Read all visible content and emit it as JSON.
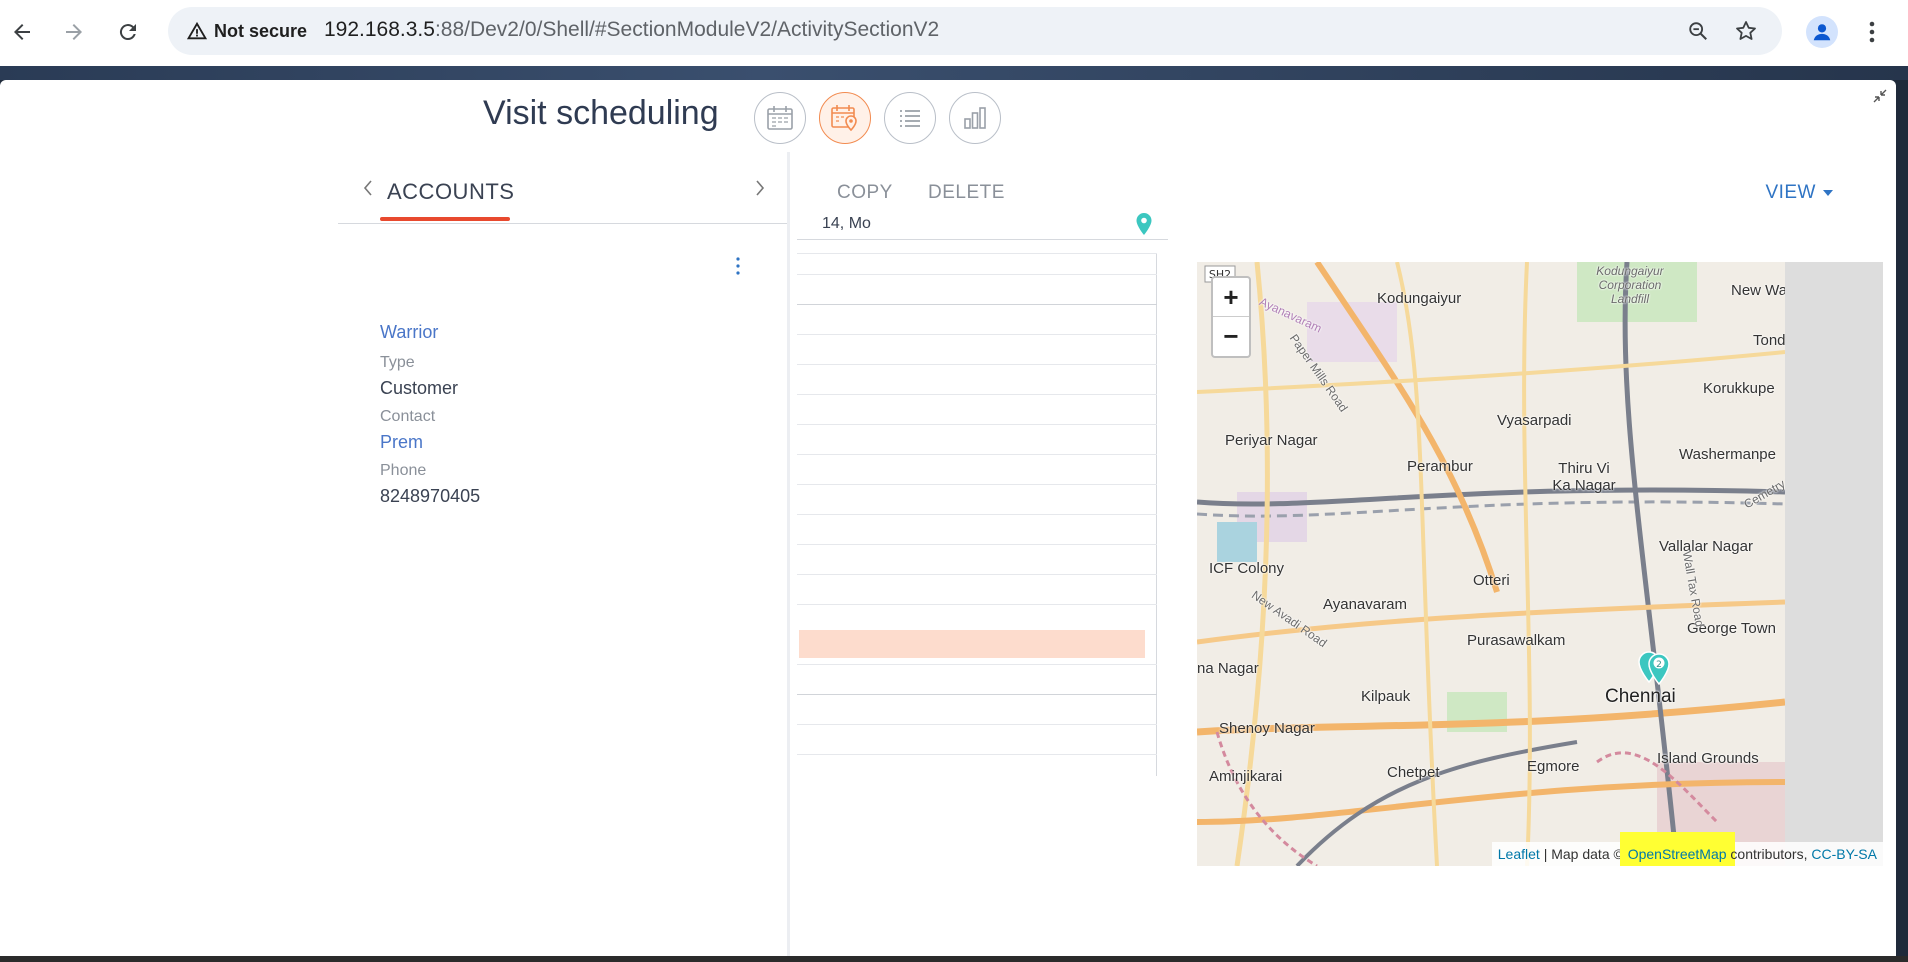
{
  "browser": {
    "security_label": "Not secure",
    "url_host": "192.168.3.5",
    "url_rest": ":88/Dev2/0/Shell/#SectionModuleV2/ActivitySectionV2",
    "icons": [
      "back-arrow-icon",
      "forward-arrow-icon",
      "reload-icon",
      "warning-icon",
      "zoom-icon",
      "star-icon",
      "profile-icon",
      "kebab-menu-icon"
    ]
  },
  "page": {
    "title": "Visit scheduling",
    "view_buttons": [
      {
        "name": "calendar-view",
        "icon": "calendar-icon",
        "active": false
      },
      {
        "name": "calendar-map-view",
        "icon": "calendar-pin-icon",
        "active": true
      },
      {
        "name": "list-view",
        "icon": "list-icon",
        "active": false
      },
      {
        "name": "analytics-view",
        "icon": "bar-chart-icon",
        "active": false
      }
    ]
  },
  "left_panel": {
    "tab_label": "ACCOUNTS",
    "account": {
      "name": "Warrior",
      "type_label": "Type",
      "type_value": "Customer",
      "contact_label": "Contact",
      "contact_value": "Prem",
      "phone_label": "Phone",
      "phone_value": "8248970405"
    }
  },
  "toolbar": {
    "copy_label": "COPY",
    "delete_label": "DELETE",
    "view_label": "VIEW"
  },
  "schedule": {
    "day_label": "14, Mo"
  },
  "map": {
    "zoom_in": "+",
    "zoom_out": "−",
    "attribution_leaflet": "Leaflet",
    "attribution_mid": " | Map data © ",
    "attribution_osm": "OpenStreetMap",
    "attribution_contrib": " contributors, ",
    "attribution_license": "CC-BY-SA",
    "cluster_count": "2",
    "highway_label": "SH2",
    "labels": {
      "kodungaiyur": "Kodungaiyur",
      "landfill": "Kodungaiyur Corporation Landfill",
      "new_wa": "New Wa",
      "tond": "Tond",
      "korukkupet": "Korukkupe",
      "periyar": "Periyar Nagar",
      "vyasarpadi": "Vyasarpadi",
      "perambur": "Perambur",
      "thiru": "Thiru Vi Ka Nagar",
      "washermanpet": "Washermanpe",
      "vallalar": "Vallalar Nagar",
      "icf": "ICF Colony",
      "otteri": "Otteri",
      "ayanavaram": "Ayanavaram",
      "george": "George Town",
      "purasawalkam": "Purasawalkam",
      "chennai": "Chennai",
      "anna": "na Nagar",
      "kilpauk": "Kilpauk",
      "shenoy": "Shenoy Nagar",
      "island": "Island Grounds",
      "aminjikarai": "Aminjikarai",
      "chetpet": "Chetpet",
      "egmore": "Egmore",
      "paper_mills": "Paper Mills Road",
      "new_avadi": "New Avadi Road",
      "wall_tax": "Wall Tax Road",
      "ayanavaram_road": "Ayanavaram",
      "cemetery": "Cemetry R"
    }
  }
}
